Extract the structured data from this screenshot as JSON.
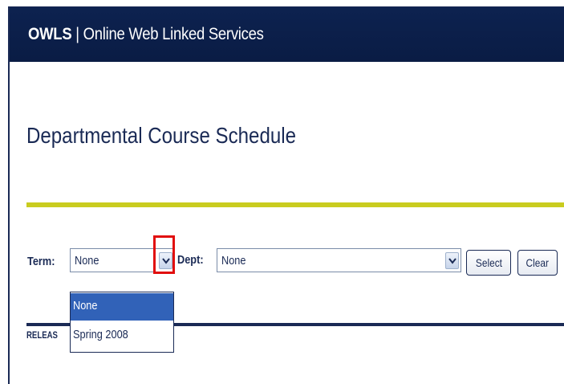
{
  "header": {
    "brand_bold": "OWLS",
    "brand_rest": " | Online Web Linked Services"
  },
  "page": {
    "title": "Departmental Course Schedule"
  },
  "filters": {
    "term_label": "Term:",
    "term_value": "None",
    "term_options": [
      "None",
      "Spring 2008"
    ],
    "term_highlighted_option": "None",
    "dept_label": "Dept:",
    "dept_value": "None",
    "select_button": "Select",
    "clear_button": "Clear"
  },
  "release_note": "RELEAS",
  "colors": {
    "header_bg": "#0d2250",
    "text_navy": "#1a2a55",
    "accent_yellow": "#c9cc1f",
    "highlight_red": "#e10e0e",
    "selection_blue": "#3162b8"
  }
}
